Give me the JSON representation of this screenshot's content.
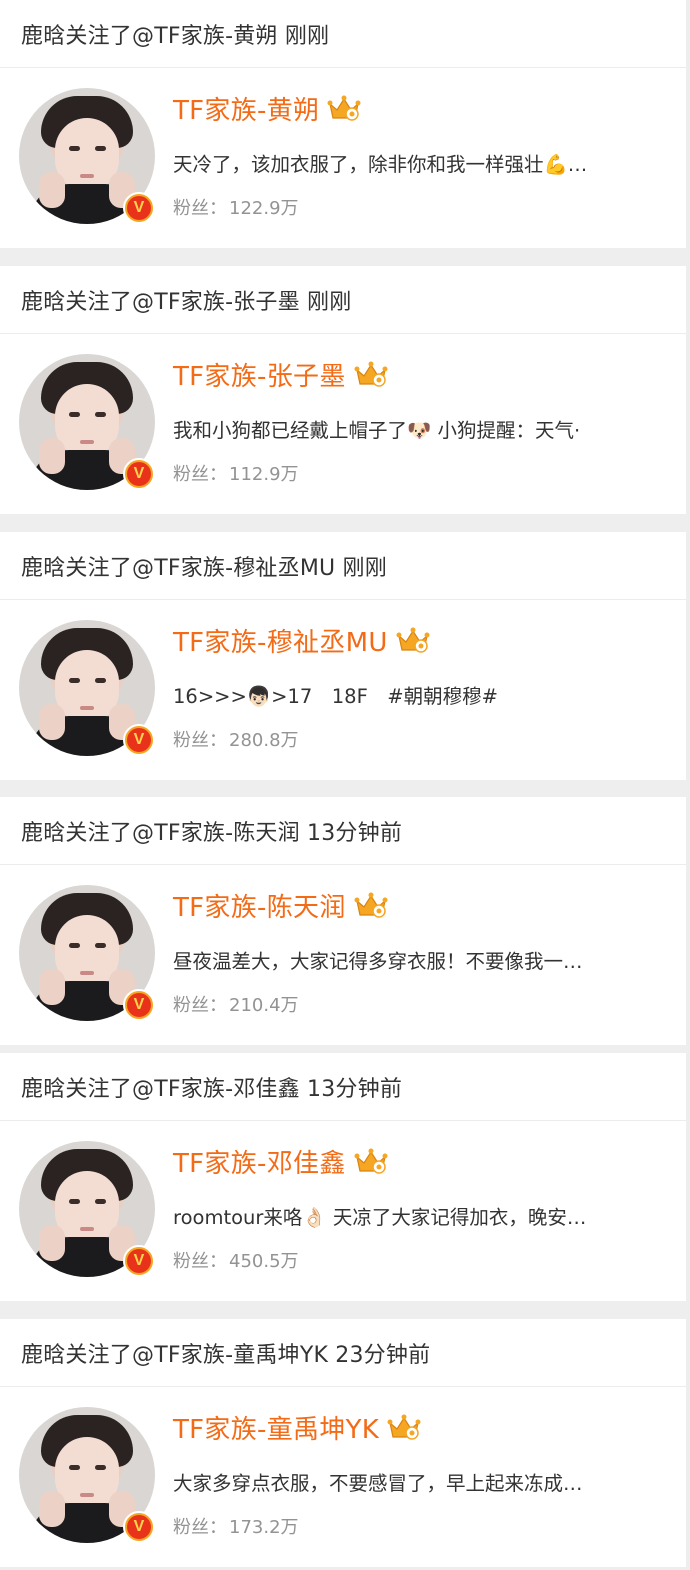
{
  "cards": [
    {
      "header": "鹿晗关注了@TF家族-黄朔 刚刚",
      "name": "TF家族-黄朔",
      "desc": "天冷了，该加衣服了，除非你和我一样强壮💪…",
      "fans_label": "粉丝：",
      "fans_value": "122.9万"
    },
    {
      "header": "鹿晗关注了@TF家族-张子墨 刚刚",
      "name": "TF家族-张子墨",
      "desc": "我和小狗都已经戴上帽子了🐶 小狗提醒：天气·",
      "fans_label": "粉丝：",
      "fans_value": "112.9万"
    },
    {
      "header": "鹿晗关注了@TF家族-穆祉丞MU 刚刚",
      "name": "TF家族-穆祉丞MU",
      "desc": "16>>>👦🏻>17　18F　#朝朝穆穆#",
      "fans_label": "粉丝：",
      "fans_value": "280.8万"
    },
    {
      "header": "鹿晗关注了@TF家族-陈天润 13分钟前",
      "name": "TF家族-陈天润",
      "desc": "昼夜温差大，大家记得多穿衣服！不要像我一…",
      "fans_label": "粉丝：",
      "fans_value": "210.4万"
    },
    {
      "header": "鹿晗关注了@TF家族-邓佳鑫 13分钟前",
      "name": "TF家族-邓佳鑫",
      "desc": "roomtour来咯👌🏻 天凉了大家记得加衣，晚安…",
      "fans_label": "粉丝：",
      "fans_value": "450.5万"
    },
    {
      "header": "鹿晗关注了@TF家族-童禹坤YK 23分钟前",
      "name": "TF家族-童禹坤YK",
      "desc": "大家多穿点衣服，不要感冒了，早上起来冻成…",
      "fans_label": "粉丝：",
      "fans_value": "173.2万"
    }
  ],
  "badges": {
    "verified_letter": "V",
    "crown_icon": "vip-crown-icon",
    "verified_icon": "verified-v-badge-icon"
  },
  "colors": {
    "name": "#f36b16",
    "desc": "#333333",
    "fans": "#939393",
    "divider": "#eeeeee",
    "crown": "#f5a623",
    "verified_badge": "#e8331a"
  }
}
